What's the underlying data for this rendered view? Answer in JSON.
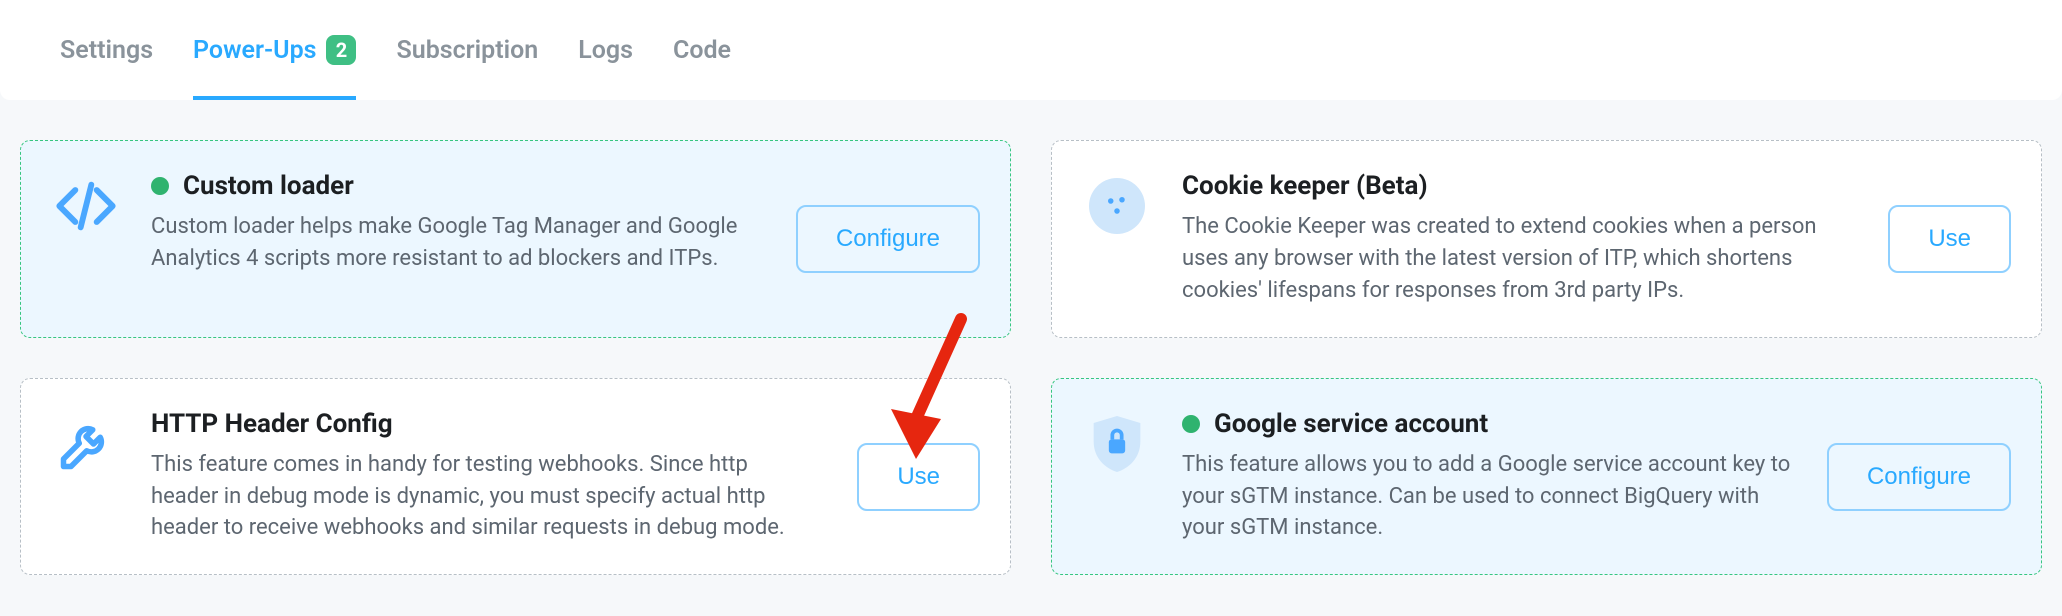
{
  "tabs": {
    "settings": "Settings",
    "powerups": "Power-Ups",
    "powerups_count": "2",
    "subscription": "Subscription",
    "logs": "Logs",
    "code": "Code"
  },
  "buttons": {
    "configure": "Configure",
    "use": "Use"
  },
  "cards": {
    "custom_loader": {
      "title": "Custom loader",
      "desc": "Custom loader helps make Google Tag Manager and Google Analytics 4 scripts more resistant to ad blockers and ITPs."
    },
    "cookie_keeper": {
      "title": "Cookie keeper (Beta)",
      "desc": "The Cookie Keeper was created to extend cookies when a person uses any browser with the latest version of ITP, which shortens cookies' lifespans for responses from 3rd party IPs."
    },
    "http_header": {
      "title": "HTTP Header Config",
      "desc": "This feature comes in handy for testing webhooks. Since http header in debug mode is dynamic, you must specify actual http header to receive webhooks and similar requests in debug mode."
    },
    "gsa": {
      "title": "Google service account",
      "desc": "This feature allows you to add a Google service account key to your sGTM instance. Can be used to connect BigQuery with your sGTM instance."
    }
  }
}
